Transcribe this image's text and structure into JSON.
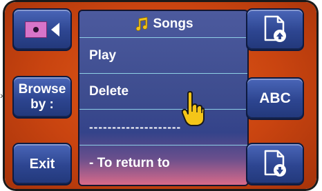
{
  "left_buttons": {
    "source": {
      "icon": "cd-source-icon",
      "arrow": "left-triangle-icon"
    },
    "browse": {
      "line1": "Browse",
      "line2": "by :"
    },
    "exit": {
      "label": "Exit"
    }
  },
  "menu": {
    "title": "Songs",
    "title_icon": "music-note-icon",
    "items": [
      {
        "label": "Play"
      },
      {
        "label": "Delete"
      },
      {
        "label": "--------------------"
      },
      {
        "label": "- To return to"
      }
    ]
  },
  "right_buttons": {
    "up": {
      "icon": "file-up-icon"
    },
    "abc": {
      "label": "ABC"
    },
    "down": {
      "icon": "file-down-icon"
    }
  },
  "pointer": {
    "icon": "hand-pointer-icon"
  },
  "colors": {
    "frame_orange": "#d24a12",
    "button_blue": "#2d4590",
    "menu_blue": "#3d4c8e",
    "separator": "#8fd0e6",
    "note_yellow": "#f2c21a"
  }
}
